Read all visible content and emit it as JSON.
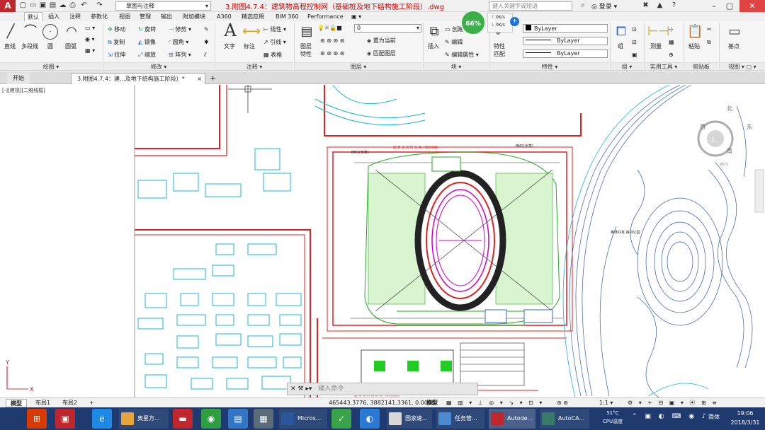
{
  "app": {
    "logo": "A",
    "workspace": "草图与注释",
    "title": "3.附图4.7.4：建筑物高程控制网（基础桩及地下结构施工阶段）.dwg",
    "search_placeholder": "键入关键字或短语",
    "login": "登录"
  },
  "network": {
    "percent": "66%",
    "up": "0K/s",
    "down": "0K/s"
  },
  "ribbon_tabs": [
    "默认",
    "插入",
    "注释",
    "参数化",
    "视图",
    "管理",
    "输出",
    "附加模块",
    "A360",
    "精选应用",
    "BIM 360",
    "Performance"
  ],
  "draw": {
    "line": "直线",
    "polyline": "多段线",
    "circle": "圆",
    "arc": "圆弧",
    "group": "绘图"
  },
  "modify": {
    "move": "移动",
    "rotate": "旋转",
    "trim": "修剪",
    "copy": "复制",
    "mirror": "镜像",
    "fillet": "圆角",
    "stretch": "拉伸",
    "scale": "缩放",
    "array": "阵列",
    "group": "修改"
  },
  "annotation": {
    "text": "文字",
    "dimension": "标注",
    "linear": "线性",
    "leader": "引线",
    "table": "表格",
    "group": "注释"
  },
  "layers": {
    "properties_line1": "图层",
    "properties_line2": "特性",
    "current_layer": "0",
    "set_current": "置为当前",
    "match": "匹配图层",
    "group": "图层"
  },
  "block": {
    "insert": "插入",
    "create": "创建",
    "edit": "编辑",
    "edit_attr": "编辑属性",
    "group": "块"
  },
  "properties": {
    "match_line1": "特性",
    "match_line2": "匹配",
    "color": "ByLayer",
    "linetype": "ByLayer",
    "lineweight": "ByLayer",
    "group": "特性"
  },
  "groups_panel": {
    "group_label": "组",
    "group": "组"
  },
  "utilities": {
    "measure": "测量",
    "group": "实用工具"
  },
  "clipboard": {
    "paste": "粘贴",
    "group": "剪贴板"
  },
  "view_panel": {
    "base": "基点",
    "group": "视图"
  },
  "file_tabs": {
    "start": "开始",
    "drawing": "3.附图4.7.4：建...及地下结构施工阶段）*"
  },
  "viewport_label": "[-][俯视][二维线框]",
  "viewcube": {
    "north": "北",
    "south": "南",
    "east": "东",
    "west": "西",
    "center": "上",
    "wcs": "WCS"
  },
  "drawing_labels": {
    "top_road": "国  家  速  滑  馆  北  路（规划道路）",
    "bottom_road": "国  家  速  滑  馆  南  路（规划道路）",
    "park": "奥林匹克\n森林公园",
    "bm1": "BM1(示意)",
    "bm2": "BM2(示意)"
  },
  "command": {
    "placeholder": "键入命令"
  },
  "layout_tabs": [
    "模型",
    "布局1",
    "布局2"
  ],
  "status": {
    "coords": "465443.3776, 3882141.3361, 0.0000",
    "mode": "模型",
    "scale": "1:1",
    "ime": "简体"
  },
  "taskbar": {
    "windows": [
      {
        "label": "奥星方...",
        "color": "#e8a33a"
      },
      {
        "label": "Micros...",
        "color": "#2b579a"
      },
      {
        "label": "国家速...",
        "color": "#d9d9d9"
      },
      {
        "label": "任务管...",
        "color": "#4a8bd4"
      },
      {
        "label": "Autode...",
        "color": "#c0272d"
      },
      {
        "label": "AutoCA...",
        "color": "#3a7a6a"
      }
    ],
    "temp": "51°C",
    "cpu": "CPU温度",
    "time": "19:06",
    "date": "2018/3/31"
  }
}
